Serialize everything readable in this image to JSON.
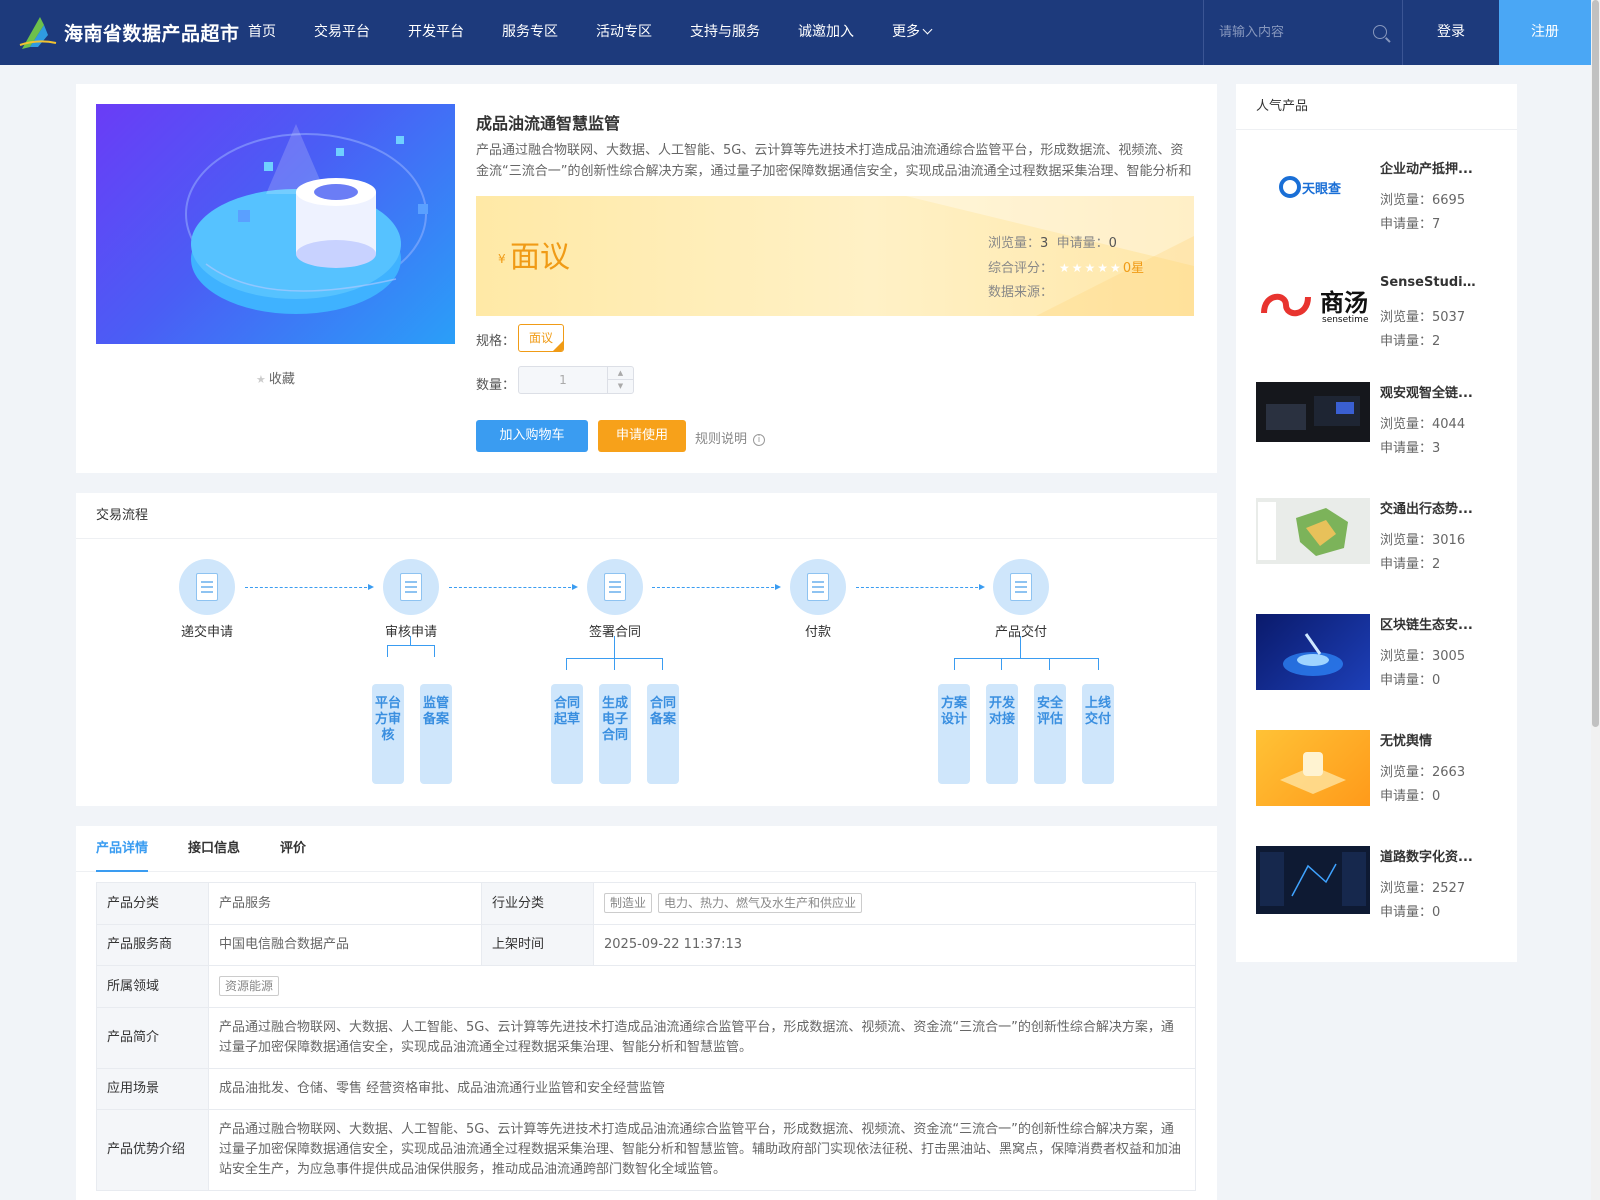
{
  "header": {
    "logo_text": "海南省数据产品超市",
    "nav": [
      {
        "label": "首页"
      },
      {
        "label": "交易平台"
      },
      {
        "label": "开发平台"
      },
      {
        "label": "服务专区"
      },
      {
        "label": "活动专区"
      },
      {
        "label": "支持与服务"
      },
      {
        "label": "诚邀加入"
      },
      {
        "label": "更多"
      }
    ],
    "search_placeholder": "请输入内容",
    "login": "登录",
    "register": "注册"
  },
  "product": {
    "title": "成品油流通智慧监管",
    "description": "产品通过融合物联网、大数据、人工智能、5G、云计算等先进技术打造成品油流通综合监管平台，形成数据流、视频流、资金流“三流合一”的创新性综合解决方案，通过量子加密保障数据通信安全，实现成品油流通全过程数据采集治理、智能分析和智慧监管。",
    "currency": "¥",
    "price": "面议",
    "views_label": "浏览量：",
    "views": "3",
    "applies_label": "申请量：",
    "applies": "0",
    "rating_label": "综合评分：",
    "rating": "0星",
    "rating_value": 0,
    "source_label": "数据来源：",
    "spec_label": "规格：",
    "spec_option": "面议",
    "qty_label": "数量：",
    "qty_value": "1",
    "add_cart": "加入购物车",
    "apply": "申请使用",
    "rules": "规则说明",
    "favorite": "收藏"
  },
  "process": {
    "title": "交易流程",
    "steps": [
      {
        "label": "递交申请"
      },
      {
        "label": "审核申请"
      },
      {
        "label": "签署合同"
      },
      {
        "label": "付款"
      },
      {
        "label": "产品交付"
      }
    ],
    "subs": {
      "review": [
        "平台方审核",
        "监管备案"
      ],
      "contract": [
        "合同起草",
        "生成电子合同",
        "合同备案"
      ],
      "delivery": [
        "方案设计",
        "开发对接",
        "安全评估",
        "上线交付"
      ]
    }
  },
  "detail": {
    "tabs": [
      {
        "label": "产品详情"
      },
      {
        "label": "接口信息"
      },
      {
        "label": "评价"
      }
    ],
    "rows": {
      "category_label": "产品分类",
      "category": "产品服务",
      "industry_label": "行业分类",
      "industry_tags": [
        "制造业",
        "电力、热力、燃气及水生产和供应业"
      ],
      "provider_label": "产品服务商",
      "provider": "中国电信融合数据产品",
      "listed_label": "上架时间",
      "listed": "2025-09-22 11:37:13",
      "domain_label": "所属领域",
      "domain_tag": "资源能源",
      "intro_label": "产品简介",
      "intro": "产品通过融合物联网、大数据、人工智能、5G、云计算等先进技术打造成品油流通综合监管平台，形成数据流、视频流、资金流“三流合一”的创新性综合解决方案，通过量子加密保障数据通信安全，实现成品油流通全过程数据采集治理、智能分析和智慧监管。",
      "scene_label": "应用场景",
      "scene": "成品油批发、仓储、零售 经营资格审批、成品油流通行业监管和安全经营监管",
      "advantage_label": "产品优势介绍",
      "advantage": "产品通过融合物联网、大数据、人工智能、5G、云计算等先进技术打造成品油流通综合监管平台，形成数据流、视频流、资金流“三流合一”的创新性综合解决方案，通过量子加密保障数据通信安全，实现成品油流通全过程数据采集治理、智能分析和智慧监管。辅助政府部门实现依法征税、打击黑油站、黑窝点，保障消费者权益和加油站安全生产，为应急事件提供成品油保供服务，推动成品油流通跨部门数智化全域监管。"
    }
  },
  "popular": {
    "title": "人气产品",
    "views_label": "浏览量：",
    "applies_label": "申请量：",
    "items": [
      {
        "name": "企业动产抵押...",
        "views": "6695",
        "applies": "7",
        "logo_text": "天眼查"
      },
      {
        "name": "SenseStudio...",
        "views": "5037",
        "applies": "2",
        "logo_text": "商汤",
        "logo_sub": "sensetime"
      },
      {
        "name": "观安观智全链...",
        "views": "4044",
        "applies": "3"
      },
      {
        "name": "交通出行态势...",
        "views": "3016",
        "applies": "2"
      },
      {
        "name": "区块链生态安...",
        "views": "3005",
        "applies": "0"
      },
      {
        "name": "无忧舆情",
        "views": "2663",
        "applies": "0"
      },
      {
        "name": "道路数字化资...",
        "views": "2527",
        "applies": "0"
      }
    ]
  },
  "colors": {
    "header": "#1d3a7c",
    "accent": "#3a9cf1",
    "orange": "#f7a11a",
    "price": "#f09b16"
  }
}
